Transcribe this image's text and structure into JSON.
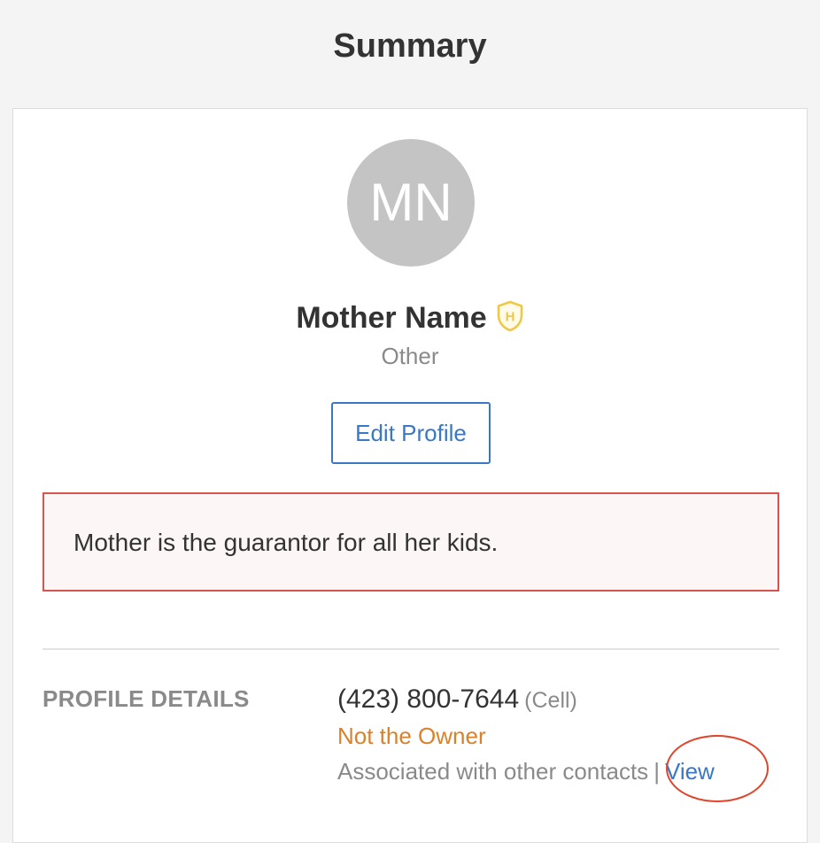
{
  "page": {
    "title": "Summary"
  },
  "profile": {
    "initials": "MN",
    "name": "Mother Name",
    "badge_letter": "H",
    "badge_icon": "hipaa-shield-icon",
    "relationship": "Other",
    "edit_label": "Edit Profile"
  },
  "alert": {
    "message": "Mother is the guarantor for all her kids."
  },
  "details": {
    "section_label": "PROFILE DETAILS",
    "phone": "(423) 800-7644",
    "phone_type": "(Cell)",
    "owner_status": "Not the Owner",
    "associated_text": "Associated with other contacts",
    "separator": "|",
    "view_label": "View"
  },
  "colors": {
    "background": "#f4f4f4",
    "card": "#ffffff",
    "avatar": "#c4c4c4",
    "link": "#3a78c3",
    "alert_border": "#d9534f",
    "alert_fill": "#fdf6f6",
    "owner_status": "#d9822b",
    "badge": "#f0c848",
    "annotation_circle": "#e0442b"
  }
}
